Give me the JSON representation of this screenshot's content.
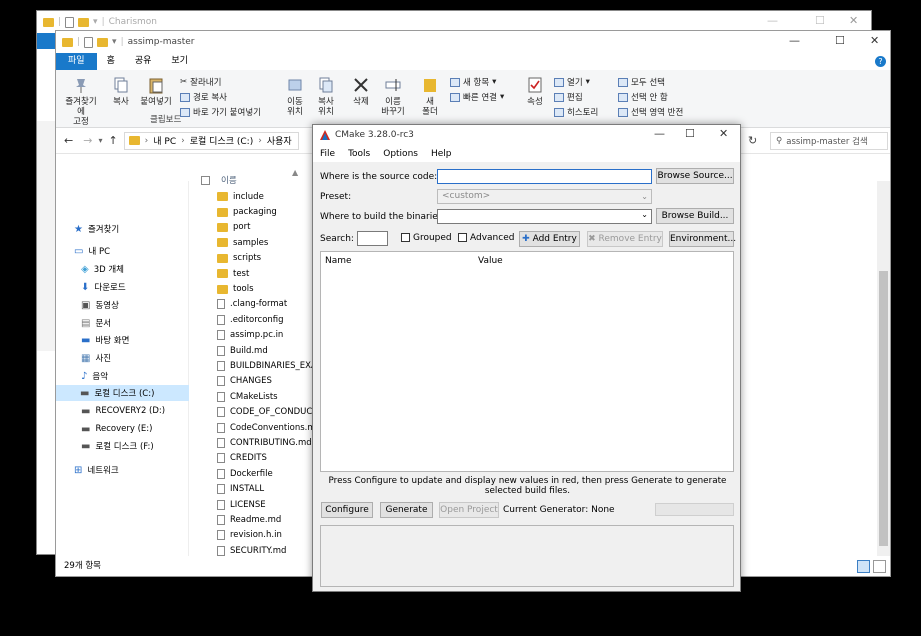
{
  "back_window": {
    "title": "Charismon"
  },
  "explorer": {
    "title": "assimp-master",
    "tabs": [
      "파일",
      "홈",
      "공유",
      "보기"
    ],
    "ribbon": {
      "pin_label": "즐겨찾기에\n고정",
      "copy_label": "복사",
      "paste_label": "붙여넣기",
      "cut_label": "잘라내기",
      "copy_path_label": "경로 복사",
      "paste_shortcut_label": "바로 가기 붙여넣기",
      "clipboard_group": "클립보드",
      "move_label": "이동\n위치",
      "copyto_label": "복사\n위치",
      "delete_label": "삭제",
      "rename_label": "이름\n바꾸기",
      "new_folder_label": "새\n폴더",
      "new_item_label": "새 항목",
      "easy_access_label": "빠른 연결",
      "properties_label": "속성",
      "open_label": "열기",
      "edit_label": "편집",
      "history_label": "히스토리",
      "select_all_label": "모두 선택",
      "select_none_label": "선택 안 함",
      "invert_label": "선택 영역 반전"
    },
    "breadcrumb": [
      "내 PC",
      "로컬 디스크 (C:)",
      "사용자"
    ],
    "search_placeholder": "assimp-master 검색",
    "nav": [
      {
        "label": "즐겨찾기",
        "icon": "star-icon"
      },
      {
        "label": "내 PC",
        "icon": "pc-icon"
      },
      {
        "label": "3D 개체",
        "icon": "cube-icon"
      },
      {
        "label": "다운로드",
        "icon": "download-icon"
      },
      {
        "label": "동영상",
        "icon": "video-icon"
      },
      {
        "label": "문서",
        "icon": "document-icon"
      },
      {
        "label": "바탕 화면",
        "icon": "desktop-icon"
      },
      {
        "label": "사진",
        "icon": "picture-icon"
      },
      {
        "label": "음악",
        "icon": "music-icon"
      },
      {
        "label": "로컬 디스크 (C:)",
        "icon": "drive-icon"
      },
      {
        "label": "RECOVERY2 (D:)",
        "icon": "drive-icon"
      },
      {
        "label": "Recovery (E:)",
        "icon": "drive-icon"
      },
      {
        "label": "로컬 디스크 (F:)",
        "icon": "drive-icon"
      },
      {
        "label": "네트워크",
        "icon": "network-icon"
      }
    ],
    "column_name": "이름",
    "files": [
      {
        "name": "include",
        "type": "folder"
      },
      {
        "name": "packaging",
        "type": "folder"
      },
      {
        "name": "port",
        "type": "folder"
      },
      {
        "name": "samples",
        "type": "folder"
      },
      {
        "name": "scripts",
        "type": "folder"
      },
      {
        "name": "test",
        "type": "folder"
      },
      {
        "name": "tools",
        "type": "folder"
      },
      {
        "name": ".clang-format",
        "type": "file"
      },
      {
        "name": ".editorconfig",
        "type": "file"
      },
      {
        "name": "assimp.pc.in",
        "type": "file"
      },
      {
        "name": "Build.md",
        "type": "file"
      },
      {
        "name": "BUILDBINARIES_EXAI",
        "type": "file"
      },
      {
        "name": "CHANGES",
        "type": "file"
      },
      {
        "name": "CMakeLists",
        "type": "file"
      },
      {
        "name": "CODE_OF_CONDUCT",
        "type": "file"
      },
      {
        "name": "CodeConventions.md",
        "type": "file"
      },
      {
        "name": "CONTRIBUTING.md",
        "type": "file"
      },
      {
        "name": "CREDITS",
        "type": "file"
      },
      {
        "name": "Dockerfile",
        "type": "file"
      },
      {
        "name": "INSTALL",
        "type": "file"
      },
      {
        "name": "LICENSE",
        "type": "file"
      },
      {
        "name": "Readme.md",
        "type": "file"
      },
      {
        "name": "revision.h.in",
        "type": "file"
      },
      {
        "name": "SECURITY.md",
        "type": "file"
      }
    ],
    "status": "29개 항목"
  },
  "cmake": {
    "title": "CMake 3.28.0-rc3",
    "menu": [
      "File",
      "Tools",
      "Options",
      "Help"
    ],
    "source_label": "Where is the source code:",
    "source_value": "",
    "browse_source": "Browse Source...",
    "preset_label": "Preset:",
    "preset_value": "<custom>",
    "build_label": "Where to build the binaries:",
    "build_value": "",
    "browse_build": "Browse Build...",
    "search_label": "Search:",
    "grouped_label": "Grouped",
    "advanced_label": "Advanced",
    "add_entry": "Add Entry",
    "remove_entry": "Remove Entry",
    "environment": "Environment...",
    "col_name": "Name",
    "col_value": "Value",
    "hint": "Press Configure to update and display new values in red, then press Generate to generate selected build files.",
    "configure": "Configure",
    "generate": "Generate",
    "open_project": "Open Project",
    "current_generator": "Current Generator: None"
  }
}
